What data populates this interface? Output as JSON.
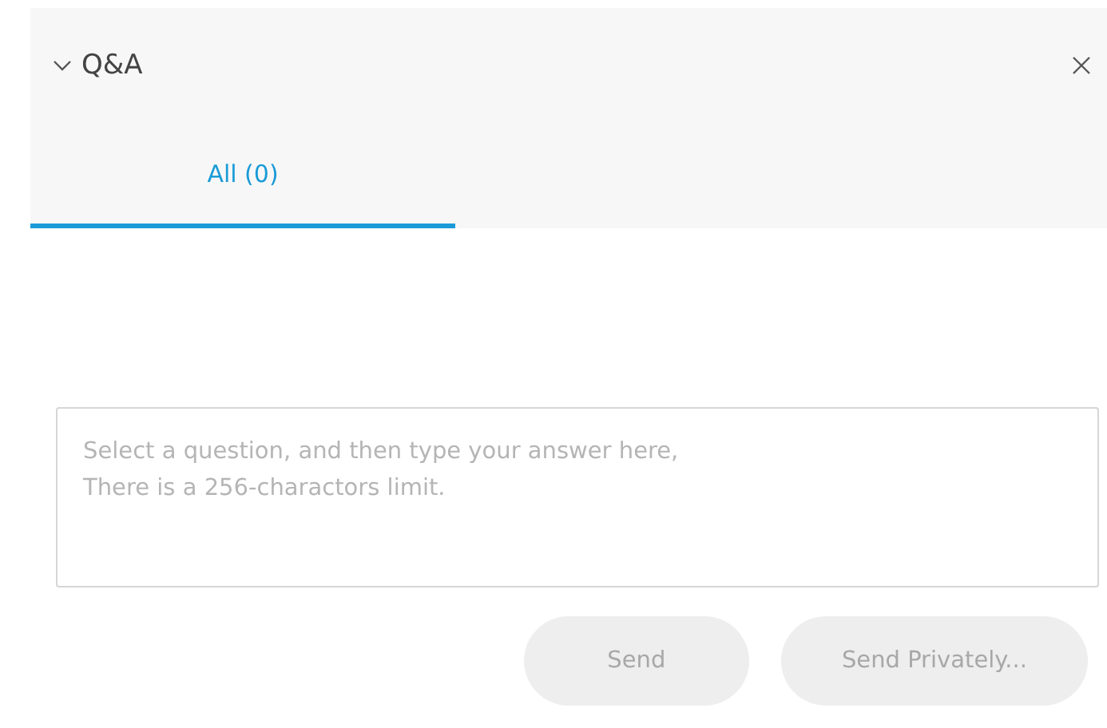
{
  "panel": {
    "title": "Q&A",
    "expanded": true
  },
  "tabs": [
    {
      "label": "All (0)",
      "selected": true
    }
  ],
  "answer": {
    "placeholder": "Select a question, and then type your answer here,\nThere is a 256-charactors limit."
  },
  "buttons": [
    {
      "label": "Send",
      "disabled": true
    },
    {
      "label": "Send Privately...",
      "disabled": true
    }
  ]
}
